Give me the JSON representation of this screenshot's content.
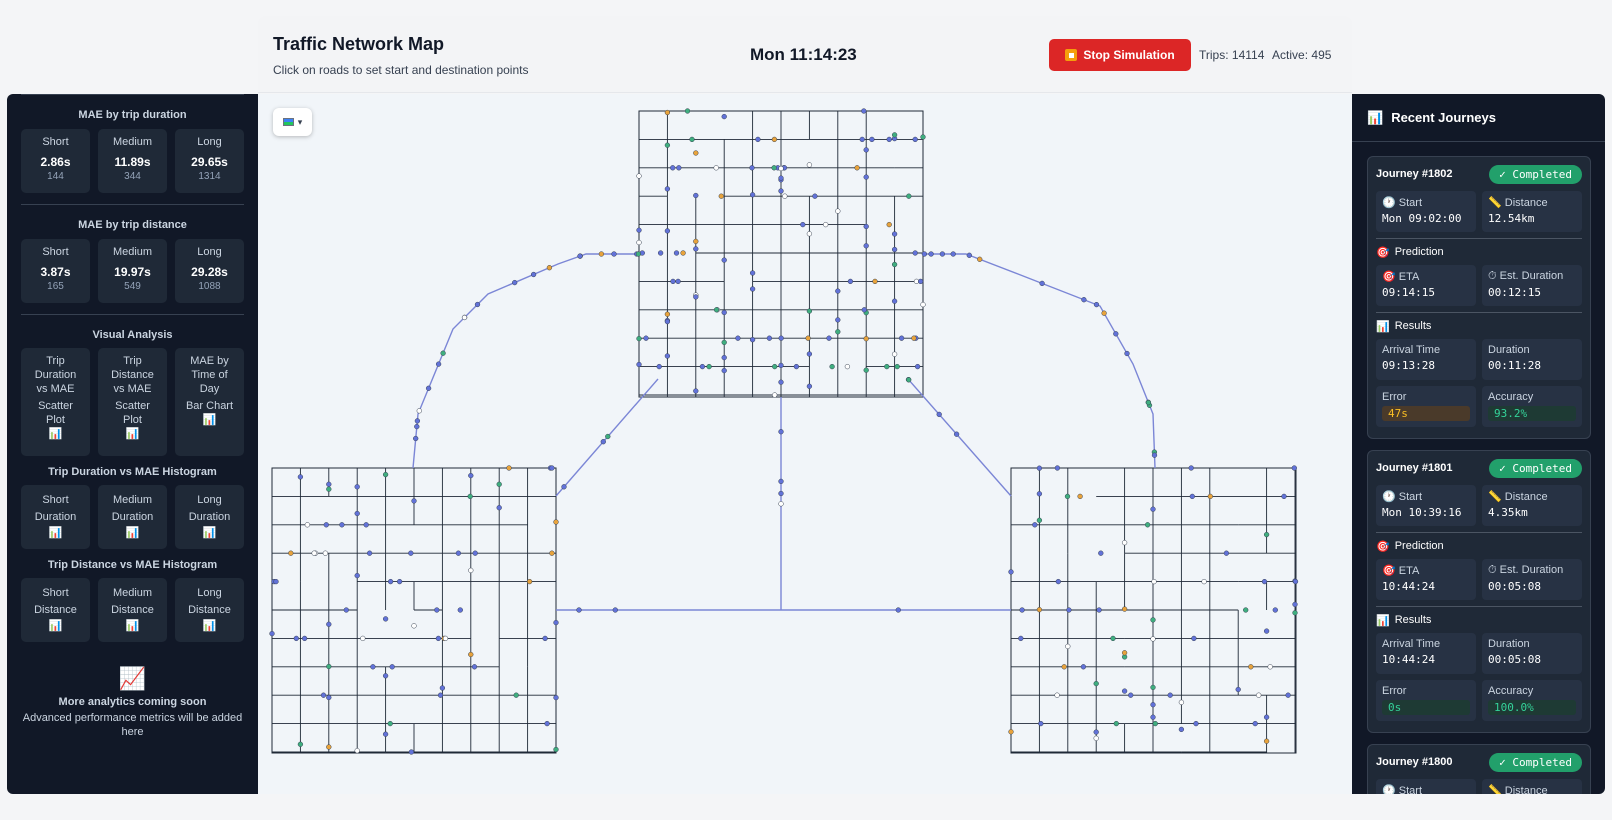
{
  "header": {
    "title": "Traffic Network Map",
    "subtitle": "Click on roads to set start and destination points",
    "clock": "Mon 11:14:23",
    "stop_label": "Stop Simulation",
    "trips_text": "Trips: 14114",
    "active_text": "Active: 495"
  },
  "analytics": {
    "mae_duration": {
      "title": "MAE by trip duration",
      "cards": [
        {
          "label": "Short",
          "value": "2.86s",
          "count": "144"
        },
        {
          "label": "Medium",
          "value": "11.89s",
          "count": "344"
        },
        {
          "label": "Long",
          "value": "29.65s",
          "count": "1314"
        }
      ]
    },
    "mae_distance": {
      "title": "MAE by trip distance",
      "cards": [
        {
          "label": "Short",
          "value": "3.87s",
          "count": "165"
        },
        {
          "label": "Medium",
          "value": "19.97s",
          "count": "549"
        },
        {
          "label": "Long",
          "value": "29.28s",
          "count": "1088"
        }
      ]
    },
    "visual": {
      "title": "Visual Analysis",
      "cards": [
        {
          "title_lines": [
            "Trip",
            "Duration",
            "vs MAE"
          ],
          "kind_lines": [
            "Scatter",
            "Plot"
          ],
          "icon": "bar-chart-icon"
        },
        {
          "title_lines": [
            "Trip",
            "Distance",
            "vs MAE"
          ],
          "kind_lines": [
            "Scatter",
            "Plot"
          ],
          "icon": "bar-chart-icon"
        },
        {
          "title_lines": [
            "MAE by",
            "Time of",
            "Day"
          ],
          "kind_lines": [
            "Bar Chart"
          ],
          "icon": "bar-chart-icon"
        }
      ]
    },
    "hist_duration": {
      "title": "Trip Duration vs MAE Histogram",
      "cards": [
        {
          "label": "Short",
          "sub": "Duration"
        },
        {
          "label": "Medium",
          "sub": "Duration"
        },
        {
          "label": "Long",
          "sub": "Duration"
        }
      ]
    },
    "hist_distance": {
      "title": "Trip Distance vs MAE Histogram",
      "cards": [
        {
          "label": "Short",
          "sub": "Distance"
        },
        {
          "label": "Medium",
          "sub": "Distance"
        },
        {
          "label": "Long",
          "sub": "Distance"
        }
      ]
    },
    "coming": {
      "icon": "line-chart-icon",
      "title": "More analytics coming soon",
      "text": "Advanced performance metrics will be added here"
    }
  },
  "map": {
    "layer_icon": "map-layers-icon",
    "layer_caret": "▾"
  },
  "journeys_panel": {
    "title": "Recent Journeys",
    "journeys": [
      {
        "title": "Journey #1802",
        "status": "✓ Completed",
        "start_label": "Start",
        "start": "Mon 09:02:00",
        "distance_label": "Distance",
        "distance": "12.54km",
        "prediction_label": "Prediction",
        "eta_label": "ETA",
        "eta": "09:14:15",
        "est_label": "Est. Duration",
        "est": "00:12:15",
        "results_label": "Results",
        "arrival_label": "Arrival Time",
        "arrival": "09:13:28",
        "duration_label": "Duration",
        "duration": "00:11:28",
        "error_label": "Error",
        "error": "47s",
        "error_state": "bad",
        "accuracy_label": "Accuracy",
        "accuracy": "93.2%"
      },
      {
        "title": "Journey #1801",
        "status": "✓ Completed",
        "start_label": "Start",
        "start": "Mon 10:39:16",
        "distance_label": "Distance",
        "distance": "4.35km",
        "prediction_label": "Prediction",
        "eta_label": "ETA",
        "eta": "10:44:24",
        "est_label": "Est. Duration",
        "est": "00:05:08",
        "results_label": "Results",
        "arrival_label": "Arrival Time",
        "arrival": "10:44:24",
        "duration_label": "Duration",
        "duration": "00:05:08",
        "error_label": "Error",
        "error": "0s",
        "error_state": "good",
        "accuracy_label": "Accuracy",
        "accuracy": "100.0%"
      },
      {
        "title": "Journey #1800",
        "status": "✓ Completed",
        "start_label": "Start",
        "distance_label": "Distance"
      }
    ]
  },
  "colors": {
    "panel_bg": "#111827",
    "card_bg": "#1f2937",
    "stop_button": "#dc2626",
    "completed_badge": "#22a06b",
    "vehicle_blue": "#6272d8",
    "vehicle_orange": "#e8a33c",
    "vehicle_green": "#3fae7f",
    "vehicle_white": "#ffffff",
    "road_color": "#1f2937",
    "highway_color": "#7b86d6"
  }
}
